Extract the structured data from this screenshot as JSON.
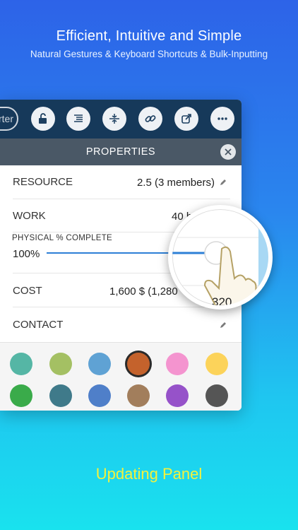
{
  "header": {
    "title": "Efficient, Intuitive and Simple",
    "subtitle": "Natural Gestures & Keyboard Shortcuts & Bulk-Inputting"
  },
  "toolbar": {
    "pill_label": "rter",
    "buttons": [
      "unlock-icon",
      "indent-icon",
      "split-icon",
      "link-icon",
      "external-link-icon",
      "more-icon"
    ]
  },
  "properties": {
    "title": "PROPERTIES",
    "rows": [
      {
        "label": "RESOURCE",
        "value": "2.5 (3 members)"
      },
      {
        "label": "WORK",
        "value": "40 h"
      },
      {
        "label": "COST",
        "value": "1,600 $ (1,280"
      },
      {
        "label": "CONTACT",
        "value": ""
      }
    ],
    "slider": {
      "label": "PHYSICAL % COMPLETE",
      "value": "100%",
      "fraction": 1.0
    },
    "magnified_value": "320"
  },
  "palette": {
    "colors": [
      "#55b6a5",
      "#a4c063",
      "#5fa2d4",
      "#c4622c",
      "#f494cf",
      "#fcd35a",
      "#3aab4a",
      "#3f7a8a",
      "#4f7fc9",
      "#a27e5c",
      "#9652c9",
      "#555555"
    ],
    "selected_index": 3
  },
  "caption": "Updating Panel"
}
